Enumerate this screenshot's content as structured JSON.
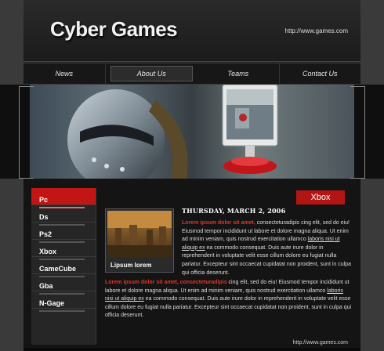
{
  "site": {
    "title": "Cyber Games",
    "url_top": "http://www.games.com",
    "url_bottom": "http://www.games.com"
  },
  "nav": {
    "items": [
      {
        "label": "News"
      },
      {
        "label": "About Us"
      },
      {
        "label": "Teams"
      },
      {
        "label": "Contact Us"
      }
    ],
    "active": "About Us"
  },
  "platform_tab": "Xbox",
  "sidebar": {
    "items": [
      {
        "label": "Pc"
      },
      {
        "label": "Ds"
      },
      {
        "label": "Ps2"
      },
      {
        "label": "Xbox"
      },
      {
        "label": "CameCube"
      },
      {
        "label": "Gba"
      },
      {
        "label": "N-Gage"
      }
    ],
    "active": "Pc"
  },
  "article": {
    "thumb_caption": "Lipsum lorem",
    "date": "THURSDAY, MARCH 2, 2006",
    "p1_lead": "Lorem ipsum dolor sit amet,",
    "p1_text_a": " consecteturadipis cing elit, sed do eiu! Eiusmod tempor incididunt ut labore et dolore magna aliqua. Ut enim ad minim veniam, quis nostrud exercitation ullamco ",
    "p1_link": "laboris nisi ut aliquip ex",
    "p1_text_b": " ea commodo consequat. Duis aute irure dolor in reprehenderit in volup­tate velit esse cillum dolore eu fugiat nulla pariatur. Excepteur sint occaecat cupidatat non proident, sunt in culpa qui officia deserunt.",
    "p2_lead": "Lorem ipsum dolor sit amet, consecteturadipis",
    "p2_text_a": " cing elit, sed do eiu! Eiusmod tempor incididunt ut labore et dolore magna aliqua. Ut enim ad minim veniam, quis nostrud exercitation ullamco ",
    "p2_link": "laboris nisi ut aliquip ex",
    "p2_text_b": " ea commodo consequat. Duis aute irure dolor in reprehenderit in voluptate velit esse cillum dolore eu fugiat nulla pariatur. Excepteur sint occaecat cupidatat non proident, sunt in culpa qui officia deserunt."
  },
  "colors": {
    "accent_red": "#c21616",
    "lead_red": "#e0342a"
  }
}
